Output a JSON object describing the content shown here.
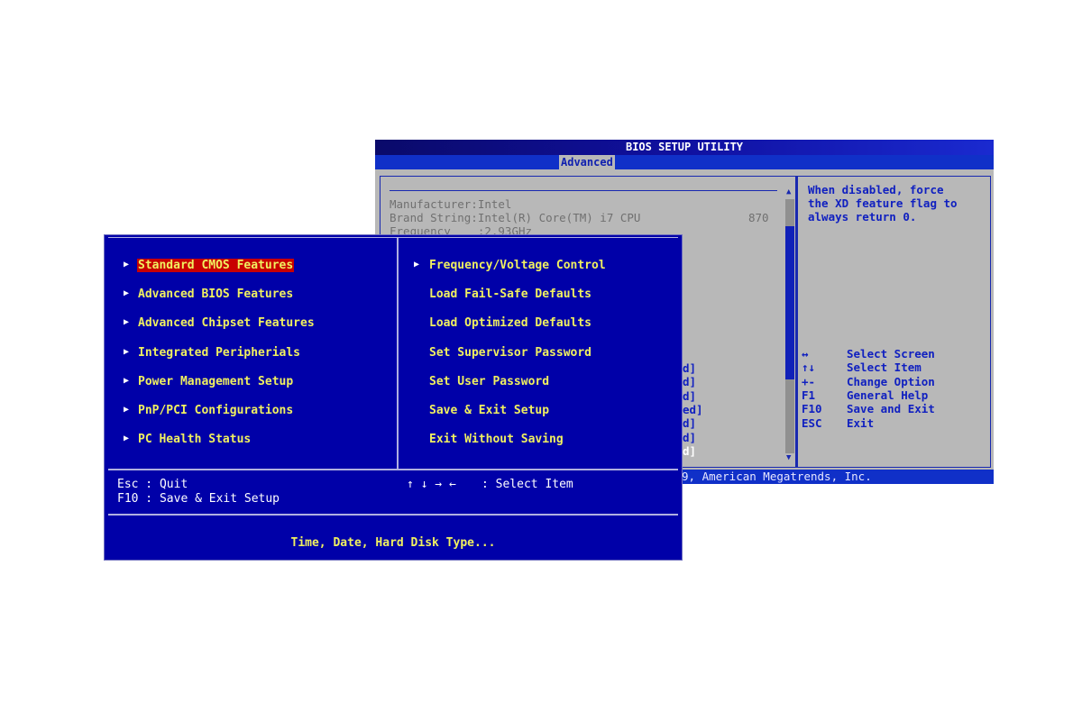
{
  "back_window": {
    "title": "BIOS SETUP UTILITY",
    "active_tab": "Advanced",
    "info_lines": [
      "Manufacturer:Intel",
      "Brand String:Intel(R) Core(TM) i7 CPU",
      "Frequency    :2.93GHz"
    ],
    "cpu_model_suffix": "870",
    "partial_values": [
      "d]",
      "d]",
      "d]",
      "ed]",
      "d]",
      "d]",
      "d]"
    ],
    "help_text": [
      "When disabled, force",
      "the XD feature flag to",
      "always return 0."
    ],
    "keys": [
      {
        "key": "↔",
        "action": "Select Screen"
      },
      {
        "key": "↑↓",
        "action": "Select Item"
      },
      {
        "key": "+-",
        "action": "Change Option"
      },
      {
        "key": "F1",
        "action": "General Help"
      },
      {
        "key": "F10",
        "action": "Save and Exit"
      },
      {
        "key": "ESC",
        "action": "Exit"
      }
    ],
    "footer": "9, American Megatrends, Inc."
  },
  "front_window": {
    "left_menu": [
      "Standard CMOS Features",
      "Advanced BIOS Features",
      "Advanced Chipset Features",
      "Integrated Peripherials",
      "Power Management Setup",
      "PnP/PCI Configurations",
      "PC Health Status"
    ],
    "right_menu": [
      "Frequency/Voltage Control",
      "Load Fail-Safe Defaults",
      "Load Optimized Defaults",
      "Set Supervisor Password",
      "Set User Password",
      "Save & Exit Setup",
      "Exit Without Saving"
    ],
    "right_menu_submenu_flags": [
      true,
      false,
      false,
      false,
      false,
      false,
      false
    ],
    "selected_index": 0,
    "footer": {
      "esc": "Esc : Quit",
      "f10": "F10 : Save & Exit Setup",
      "arrows": "↑ ↓ → ←",
      "select": ": Select Item"
    },
    "help_text": "Time, Date, Hard Disk Type...",
    "colors": {
      "background": "#0000a8",
      "text": "#f0f060",
      "selected": "#c80000"
    }
  }
}
